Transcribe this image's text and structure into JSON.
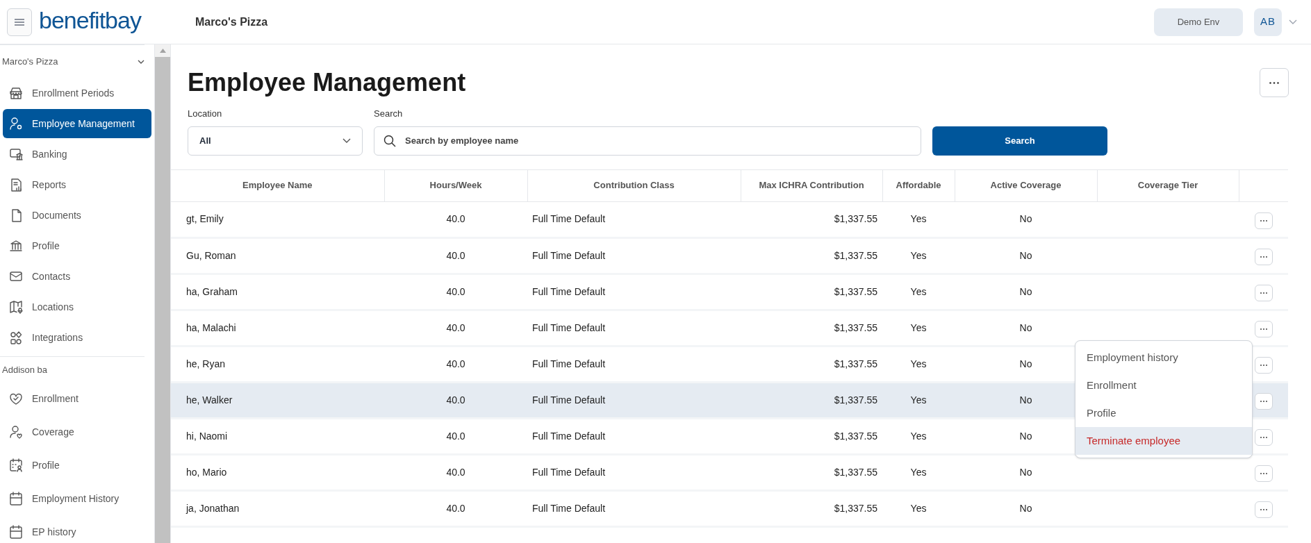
{
  "header": {
    "logo": "benefitbay",
    "company": "Marco's Pizza",
    "environment": "Demo Env",
    "avatar": "AB"
  },
  "sidebar": {
    "sections": [
      {
        "title": "Marco's Pizza",
        "expanded": true,
        "items": [
          {
            "label": "Enrollment Periods",
            "selected": false
          },
          {
            "label": "Employee Management",
            "selected": true
          },
          {
            "label": "Banking",
            "selected": false
          },
          {
            "label": "Reports",
            "selected": false
          },
          {
            "label": "Documents",
            "selected": false
          },
          {
            "label": "Profile",
            "selected": false
          },
          {
            "label": "Contacts",
            "selected": false
          },
          {
            "label": "Locations",
            "selected": false
          },
          {
            "label": "Integrations",
            "selected": false
          }
        ]
      },
      {
        "title": "Addison ba",
        "items": [
          {
            "label": "Enrollment",
            "selected": false
          },
          {
            "label": "Coverage",
            "selected": false
          },
          {
            "label": "Profile",
            "selected": false
          },
          {
            "label": "Employment History",
            "selected": false
          },
          {
            "label": "EP history",
            "selected": false
          }
        ]
      }
    ]
  },
  "page": {
    "title": "Employee Management",
    "filters": {
      "location_label": "Location",
      "location_value": "All",
      "search_label": "Search",
      "search_placeholder": "Search by employee name",
      "search_button": "Search"
    },
    "table": {
      "columns": [
        "Employee Name",
        "Hours/Week",
        "Contribution Class",
        "Max ICHRA Contribution",
        "Affordable",
        "Active Coverage",
        "Coverage Tier"
      ],
      "rows": [
        {
          "name": "gt, Emily",
          "hours": "40.0",
          "class": "Full Time Default",
          "max": "$1,337.55",
          "affordable": "Yes",
          "active": "No",
          "selected": false
        },
        {
          "name": "Gu, Roman",
          "hours": "40.0",
          "class": "Full Time Default",
          "max": "$1,337.55",
          "affordable": "Yes",
          "active": "No",
          "selected": false
        },
        {
          "name": "ha, Graham",
          "hours": "40.0",
          "class": "Full Time Default",
          "max": "$1,337.55",
          "affordable": "Yes",
          "active": "No",
          "selected": false
        },
        {
          "name": "ha, Malachi",
          "hours": "40.0",
          "class": "Full Time Default",
          "max": "$1,337.55",
          "affordable": "Yes",
          "active": "No",
          "selected": false
        },
        {
          "name": "he, Ryan",
          "hours": "40.0",
          "class": "Full Time Default",
          "max": "$1,337.55",
          "affordable": "Yes",
          "active": "No",
          "selected": false
        },
        {
          "name": "he, Walker",
          "hours": "40.0",
          "class": "Full Time Default",
          "max": "$1,337.55",
          "affordable": "Yes",
          "active": "No",
          "selected": true
        },
        {
          "name": "hi, Naomi",
          "hours": "40.0",
          "class": "Full Time Default",
          "max": "$1,337.55",
          "affordable": "Yes",
          "active": "No",
          "selected": false
        },
        {
          "name": "ho, Mario",
          "hours": "40.0",
          "class": "Full Time Default",
          "max": "$1,337.55",
          "affordable": "Yes",
          "active": "No",
          "selected": false
        },
        {
          "name": "ja, Jonathan",
          "hours": "40.0",
          "class": "Full Time Default",
          "max": "$1,337.55",
          "affordable": "Yes",
          "active": "No",
          "selected": false
        }
      ]
    },
    "row_menu": {
      "items": [
        {
          "label": "Employment history",
          "kind": "normal",
          "selected": false
        },
        {
          "label": "Enrollment",
          "kind": "normal",
          "selected": false
        },
        {
          "label": "Profile",
          "kind": "normal",
          "selected": false
        },
        {
          "label": "Terminate employee",
          "kind": "danger",
          "selected": true
        }
      ]
    }
  }
}
